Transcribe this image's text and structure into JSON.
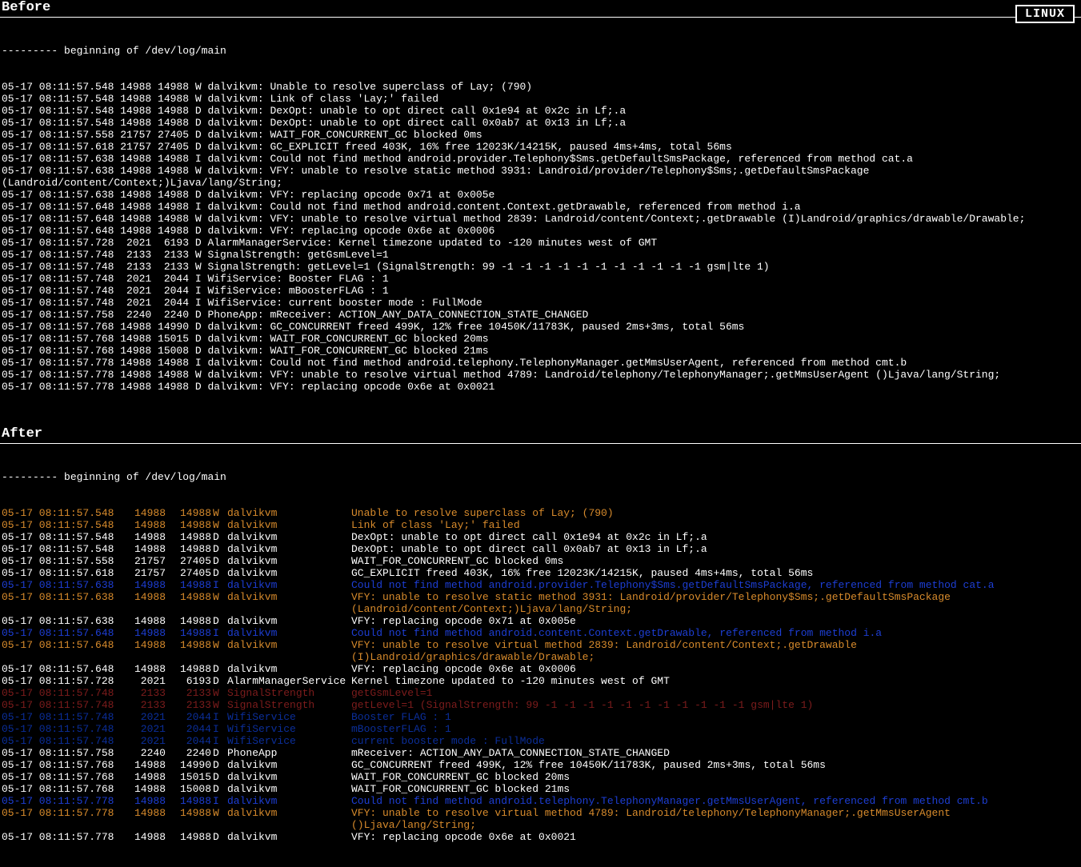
{
  "headers": {
    "before": "Before",
    "after": "After"
  },
  "badge": "LINUX",
  "before": {
    "header": "--------- beginning of /dev/log/main",
    "lines": [
      "05-17 08:11:57.548 14988 14988 W dalvikvm: Unable to resolve superclass of Lay; (790)",
      "05-17 08:11:57.548 14988 14988 W dalvikvm: Link of class 'Lay;' failed",
      "05-17 08:11:57.548 14988 14988 D dalvikvm: DexOpt: unable to opt direct call 0x1e94 at 0x2c in Lf;.a",
      "05-17 08:11:57.548 14988 14988 D dalvikvm: DexOpt: unable to opt direct call 0x0ab7 at 0x13 in Lf;.a",
      "05-17 08:11:57.558 21757 27405 D dalvikvm: WAIT_FOR_CONCURRENT_GC blocked 0ms",
      "05-17 08:11:57.618 21757 27405 D dalvikvm: GC_EXPLICIT freed 403K, 16% free 12023K/14215K, paused 4ms+4ms, total 56ms",
      "05-17 08:11:57.638 14988 14988 I dalvikvm: Could not find method android.provider.Telephony$Sms.getDefaultSmsPackage, referenced from method cat.a",
      "05-17 08:11:57.638 14988 14988 W dalvikvm: VFY: unable to resolve static method 3931: Landroid/provider/Telephony$Sms;.getDefaultSmsPackage (Landroid/content/Context;)Ljava/lang/String;",
      "05-17 08:11:57.638 14988 14988 D dalvikvm: VFY: replacing opcode 0x71 at 0x005e",
      "05-17 08:11:57.648 14988 14988 I dalvikvm: Could not find method android.content.Context.getDrawable, referenced from method i.a",
      "05-17 08:11:57.648 14988 14988 W dalvikvm: VFY: unable to resolve virtual method 2839: Landroid/content/Context;.getDrawable (I)Landroid/graphics/drawable/Drawable;",
      "05-17 08:11:57.648 14988 14988 D dalvikvm: VFY: replacing opcode 0x6e at 0x0006",
      "05-17 08:11:57.728  2021  6193 D AlarmManagerService: Kernel timezone updated to -120 minutes west of GMT",
      "05-17 08:11:57.748  2133  2133 W SignalStrength: getGsmLevel=1",
      "05-17 08:11:57.748  2133  2133 W SignalStrength: getLevel=1 (SignalStrength: 99 -1 -1 -1 -1 -1 -1 -1 -1 -1 -1 -1 gsm|lte 1)",
      "05-17 08:11:57.748  2021  2044 I WifiService: Booster FLAG : 1",
      "05-17 08:11:57.748  2021  2044 I WifiService: mBoosterFLAG : 1",
      "05-17 08:11:57.748  2021  2044 I WifiService: current booster mode : FullMode",
      "05-17 08:11:57.758  2240  2240 D PhoneApp: mReceiver: ACTION_ANY_DATA_CONNECTION_STATE_CHANGED",
      "05-17 08:11:57.768 14988 14990 D dalvikvm: GC_CONCURRENT freed 499K, 12% free 10450K/11783K, paused 2ms+3ms, total 56ms",
      "05-17 08:11:57.768 14988 15015 D dalvikvm: WAIT_FOR_CONCURRENT_GC blocked 20ms",
      "05-17 08:11:57.768 14988 15008 D dalvikvm: WAIT_FOR_CONCURRENT_GC blocked 21ms",
      "05-17 08:11:57.778 14988 14988 I dalvikvm: Could not find method android.telephony.TelephonyManager.getMmsUserAgent, referenced from method cmt.b",
      "05-17 08:11:57.778 14988 14988 W dalvikvm: VFY: unable to resolve virtual method 4789: Landroid/telephony/TelephonyManager;.getMmsUserAgent ()Ljava/lang/String;",
      "05-17 08:11:57.778 14988 14988 D dalvikvm: VFY: replacing opcode 0x6e at 0x0021"
    ]
  },
  "after": {
    "header": "--------- beginning of /dev/log/main",
    "rows": [
      {
        "ts": "05-17 08:11:57.548",
        "pid": "14988",
        "tid": "14988",
        "lvl": "W",
        "tag": "dalvikvm",
        "msg": "Unable to resolve superclass of Lay; (790)",
        "cls": "lvl-W"
      },
      {
        "ts": "05-17 08:11:57.548",
        "pid": "14988",
        "tid": "14988",
        "lvl": "W",
        "tag": "dalvikvm",
        "msg": "Link of class 'Lay;' failed",
        "cls": "lvl-W"
      },
      {
        "ts": "05-17 08:11:57.548",
        "pid": "14988",
        "tid": "14988",
        "lvl": "D",
        "tag": "dalvikvm",
        "msg": "DexOpt: unable to opt direct call 0x1e94 at 0x2c in Lf;.a",
        "cls": "lvl-D"
      },
      {
        "ts": "05-17 08:11:57.548",
        "pid": "14988",
        "tid": "14988",
        "lvl": "D",
        "tag": "dalvikvm",
        "msg": "DexOpt: unable to opt direct call 0x0ab7 at 0x13 in Lf;.a",
        "cls": "lvl-D"
      },
      {
        "ts": "05-17 08:11:57.558",
        "pid": "21757",
        "tid": "27405",
        "lvl": "D",
        "tag": "dalvikvm",
        "msg": "WAIT_FOR_CONCURRENT_GC blocked 0ms",
        "cls": "lvl-D"
      },
      {
        "ts": "05-17 08:11:57.618",
        "pid": "21757",
        "tid": "27405",
        "lvl": "D",
        "tag": "dalvikvm",
        "msg": "GC_EXPLICIT freed 403K, 16% free 12023K/14215K, paused 4ms+4ms, total 56ms",
        "cls": "lvl-D"
      },
      {
        "ts": "05-17 08:11:57.638",
        "pid": "14988",
        "tid": "14988",
        "lvl": "I",
        "tag": "dalvikvm",
        "msg": "Could not find method android.provider.Telephony$Sms.getDefaultSmsPackage, referenced from method cat.a",
        "cls": "lvl-I"
      },
      {
        "ts": "05-17 08:11:57.638",
        "pid": "14988",
        "tid": "14988",
        "lvl": "W",
        "tag": "dalvikvm",
        "msg": "VFY: unable to resolve static method 3931: Landroid/provider/Telephony$Sms;.getDefaultSmsPackage (Landroid/content/Context;)Ljava/lang/String;",
        "cls": "lvl-W"
      },
      {
        "ts": "05-17 08:11:57.638",
        "pid": "14988",
        "tid": "14988",
        "lvl": "D",
        "tag": "dalvikvm",
        "msg": "VFY: replacing opcode 0x71 at 0x005e",
        "cls": "lvl-D"
      },
      {
        "ts": "05-17 08:11:57.648",
        "pid": "14988",
        "tid": "14988",
        "lvl": "I",
        "tag": "dalvikvm",
        "msg": "Could not find method android.content.Context.getDrawable, referenced from method i.a",
        "cls": "lvl-I"
      },
      {
        "ts": "05-17 08:11:57.648",
        "pid": "14988",
        "tid": "14988",
        "lvl": "W",
        "tag": "dalvikvm",
        "msg": "VFY: unable to resolve virtual method 2839: Landroid/content/Context;.getDrawable (I)Landroid/graphics/drawable/Drawable;",
        "cls": "lvl-W"
      },
      {
        "ts": "05-17 08:11:57.648",
        "pid": "14988",
        "tid": "14988",
        "lvl": "D",
        "tag": "dalvikvm",
        "msg": "VFY: replacing opcode 0x6e at 0x0006",
        "cls": "lvl-D"
      },
      {
        "ts": "05-17 08:11:57.728",
        "pid": "2021",
        "tid": "6193",
        "lvl": "D",
        "tag": "AlarmManagerService",
        "msg": "Kernel timezone updated to -120 minutes west of GMT",
        "cls": "lvl-D"
      },
      {
        "ts": "05-17 08:11:57.748",
        "pid": "2133",
        "tid": "2133",
        "lvl": "W",
        "tag": "SignalStrength",
        "msg": "getGsmLevel=1",
        "cls": "lvl-sig"
      },
      {
        "ts": "05-17 08:11:57.748",
        "pid": "2133",
        "tid": "2133",
        "lvl": "W",
        "tag": "SignalStrength",
        "msg": "getLevel=1 (SignalStrength: 99 -1 -1 -1 -1 -1 -1 -1 -1 -1 -1 -1 gsm|lte 1)",
        "cls": "lvl-sig"
      },
      {
        "ts": "05-17 08:11:57.748",
        "pid": "2021",
        "tid": "2044",
        "lvl": "I",
        "tag": "WifiService",
        "msg": "Booster FLAG : 1",
        "cls": "lvl-Iw"
      },
      {
        "ts": "05-17 08:11:57.748",
        "pid": "2021",
        "tid": "2044",
        "lvl": "I",
        "tag": "WifiService",
        "msg": "mBoosterFLAG : 1",
        "cls": "lvl-Iw"
      },
      {
        "ts": "05-17 08:11:57.748",
        "pid": "2021",
        "tid": "2044",
        "lvl": "I",
        "tag": "WifiService",
        "msg": "current booster mode : FullMode",
        "cls": "lvl-Iw"
      },
      {
        "ts": "05-17 08:11:57.758",
        "pid": "2240",
        "tid": "2240",
        "lvl": "D",
        "tag": "PhoneApp",
        "msg": "mReceiver: ACTION_ANY_DATA_CONNECTION_STATE_CHANGED",
        "cls": "lvl-D"
      },
      {
        "ts": "05-17 08:11:57.768",
        "pid": "14988",
        "tid": "14990",
        "lvl": "D",
        "tag": "dalvikvm",
        "msg": "GC_CONCURRENT freed 499K, 12% free 10450K/11783K, paused 2ms+3ms, total 56ms",
        "cls": "lvl-D"
      },
      {
        "ts": "05-17 08:11:57.768",
        "pid": "14988",
        "tid": "15015",
        "lvl": "D",
        "tag": "dalvikvm",
        "msg": "WAIT_FOR_CONCURRENT_GC blocked 20ms",
        "cls": "lvl-D"
      },
      {
        "ts": "05-17 08:11:57.768",
        "pid": "14988",
        "tid": "15008",
        "lvl": "D",
        "tag": "dalvikvm",
        "msg": "WAIT_FOR_CONCURRENT_GC blocked 21ms",
        "cls": "lvl-D"
      },
      {
        "ts": "05-17 08:11:57.778",
        "pid": "14988",
        "tid": "14988",
        "lvl": "I",
        "tag": "dalvikvm",
        "msg": "Could not find method android.telephony.TelephonyManager.getMmsUserAgent, referenced from method cmt.b",
        "cls": "lvl-I"
      },
      {
        "ts": "05-17 08:11:57.778",
        "pid": "14988",
        "tid": "14988",
        "lvl": "W",
        "tag": "dalvikvm",
        "msg": "VFY: unable to resolve virtual method 4789: Landroid/telephony/TelephonyManager;.getMmsUserAgent ()Ljava/lang/String;",
        "cls": "lvl-W"
      },
      {
        "ts": "05-17 08:11:57.778",
        "pid": "14988",
        "tid": "14988",
        "lvl": "D",
        "tag": "dalvikvm",
        "msg": "VFY: replacing opcode 0x6e at 0x0021",
        "cls": "lvl-D"
      }
    ]
  }
}
